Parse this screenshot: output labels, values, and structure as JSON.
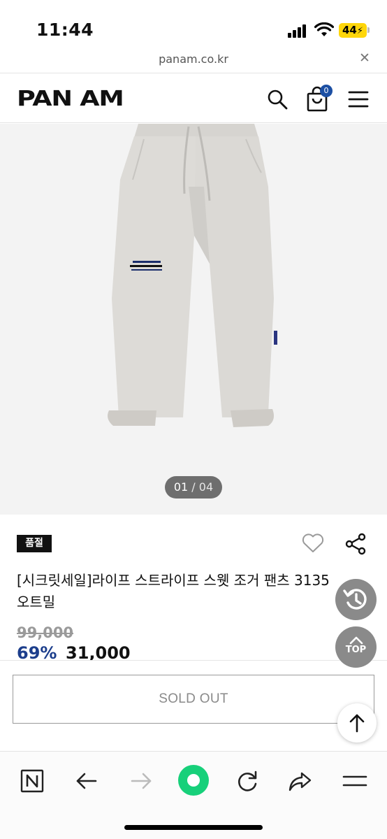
{
  "status_bar": {
    "time": "11:44",
    "battery": "44"
  },
  "browser": {
    "url": "panam.co.kr",
    "close_label": "✕"
  },
  "header": {
    "logo": "PAN AM",
    "cart_count": "0",
    "accent": "#1c4fa3"
  },
  "gallery": {
    "current": "01",
    "separator": "/",
    "total": "04",
    "product_color": "#dcdad6"
  },
  "product": {
    "badge": "품절",
    "name_line1": "[시크릿세일]라이프 스트라이프 스웻 조거 팬츠 3135",
    "name_line2": "오트밀",
    "original_price": "99,000",
    "discount_rate": "69%",
    "sale_price": "31,000",
    "discount_color": "#1c3e8c"
  },
  "floating": {
    "top_label": "TOP"
  },
  "purchase": {
    "button_label": "SOLD OUT"
  },
  "icons": {
    "header": [
      "search-icon",
      "cart-icon",
      "menu-icon"
    ],
    "toolbar": [
      "naver-n-icon",
      "back-arrow-icon",
      "forward-arrow-icon",
      "home-green-icon",
      "refresh-icon",
      "share-arrow-icon",
      "more-menu-icon"
    ]
  }
}
